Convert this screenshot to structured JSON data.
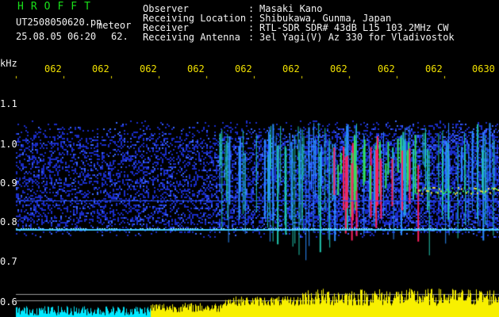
{
  "header": {
    "brand": "HROFFT",
    "file_name": "UT2508050620.pn",
    "event_type": "meteor",
    "datetime": "25.08.05 06:20",
    "count": "62.",
    "labels": [
      "Observer",
      "Receiving Location",
      "Receiver",
      "Receiving Antenna"
    ],
    "separator": ":",
    "values": [
      "Masaki Kano",
      "Shibukawa, Gunma, Japan",
      "RTL-SDR SDR# 43dB L15 103.2MHz CW",
      "3el Yagi(V) Az 330 for Vladivostok"
    ]
  },
  "axis": {
    "unit": "kHz",
    "y_ticks": [
      "1.1",
      "1.0",
      "0.9",
      "0.8",
      "0.7",
      "0.6"
    ],
    "time_ticks": [
      "062",
      "062",
      "062",
      "062",
      "062",
      "062",
      "062",
      "062",
      "062",
      "0630"
    ]
  },
  "colors": {
    "background": "#000000",
    "text": "#f2f2f2",
    "brand": "#19e019",
    "ticks": "#f0e000",
    "echo_high": "#ff2060",
    "echo_mid": "#30e060",
    "noise": "#1a2cc8",
    "signal_line": "#40c8ff",
    "meter": "#f8f000",
    "meter_low": "#00e8ff"
  }
}
